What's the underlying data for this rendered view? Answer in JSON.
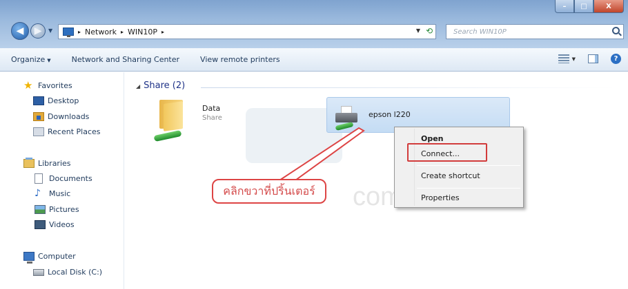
{
  "window": {
    "min_glyph": "–",
    "max_glyph": "□",
    "close_glyph": "X"
  },
  "address": {
    "crumbs": [
      "Network",
      "WIN10P"
    ],
    "separator": "▸",
    "search_placeholder": "Search WIN10P"
  },
  "toolbar": {
    "organize": "Organize",
    "network_sharing": "Network and Sharing Center",
    "view_printers": "View remote printers",
    "dropdown_glyph": "▼",
    "help_glyph": "?"
  },
  "sidebar": {
    "favorites": "Favorites",
    "desktop": "Desktop",
    "downloads": "Downloads",
    "recent": "Recent Places",
    "libraries": "Libraries",
    "documents": "Documents",
    "music": "Music",
    "pictures": "Pictures",
    "videos": "Videos",
    "computer": "Computer",
    "local_disk": "Local Disk (C:)"
  },
  "content": {
    "group_header": "Share (2)",
    "data_title": "Data",
    "data_subtitle": "Share",
    "printer_title": "epson l220"
  },
  "context_menu": {
    "open": "Open",
    "connect": "Connect...",
    "create_shortcut": "Create shortcut",
    "properties": "Properties"
  },
  "annotation": {
    "text": "คลิกขวาที่ปริ้นเตอร์",
    "color": "#d44a4a"
  },
  "watermark": {
    "text": "com"
  }
}
